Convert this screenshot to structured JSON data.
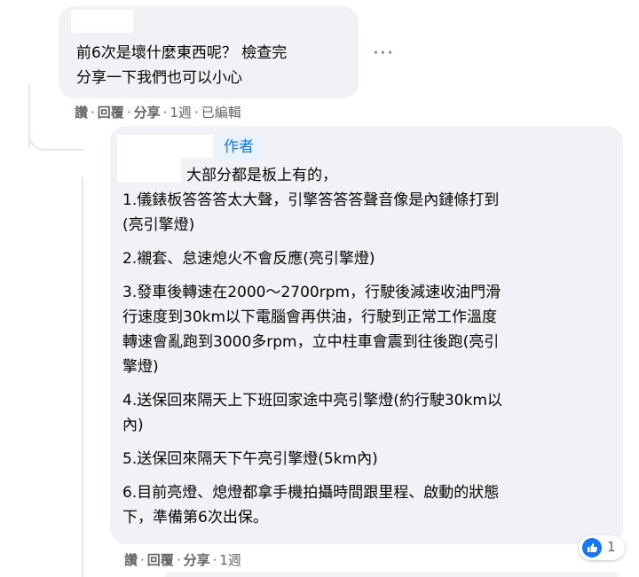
{
  "top_comment": {
    "lines": [
      "前6次是壞什麼東西呢？ 檢查完",
      "分享一下我們也可以小心"
    ],
    "actions": {
      "like": "讚",
      "reply": "回覆",
      "share": "分享",
      "time": "1週",
      "edited": "已編輯"
    }
  },
  "more_menu": {
    "icon": "···"
  },
  "reply_comment": {
    "badge": "作者",
    "intro": "大部分都是板上有的，",
    "items": [
      [
        "1.儀錶板答答答太大聲，引擎答答答聲音像是內鏈條打到",
        "(亮引擎燈)"
      ],
      [
        "2.襯套、怠速熄火不會反應(亮引擎燈)"
      ],
      [
        "3.發車後轉速在2000～2700rpm，行駛後減速收油門滑",
        "行速度到30km以下電腦會再供油，行駛到正常工作溫度",
        "轉速會亂跑到3000多rpm，立中柱車會震到往後跑(亮引",
        "擎燈)"
      ],
      [
        "4.送保回來隔天上下班回家途中亮引擎燈(約行駛30km以",
        "內)"
      ],
      [
        "5.送保回來隔天下午亮引擎燈(5km內)"
      ],
      [
        "6.目前亮燈、熄燈都拿手機拍攝時間跟里程、啟動的狀態",
        "下，準備第6次出保。"
      ]
    ],
    "actions": {
      "like": "讚",
      "reply": "回覆",
      "share": "分享",
      "time": "1週"
    },
    "reaction": {
      "icon": "like-icon",
      "count": "1"
    }
  },
  "colors": {
    "bubble": "#f0f2f5",
    "accent": "#1877f2",
    "muted": "#65676b"
  }
}
